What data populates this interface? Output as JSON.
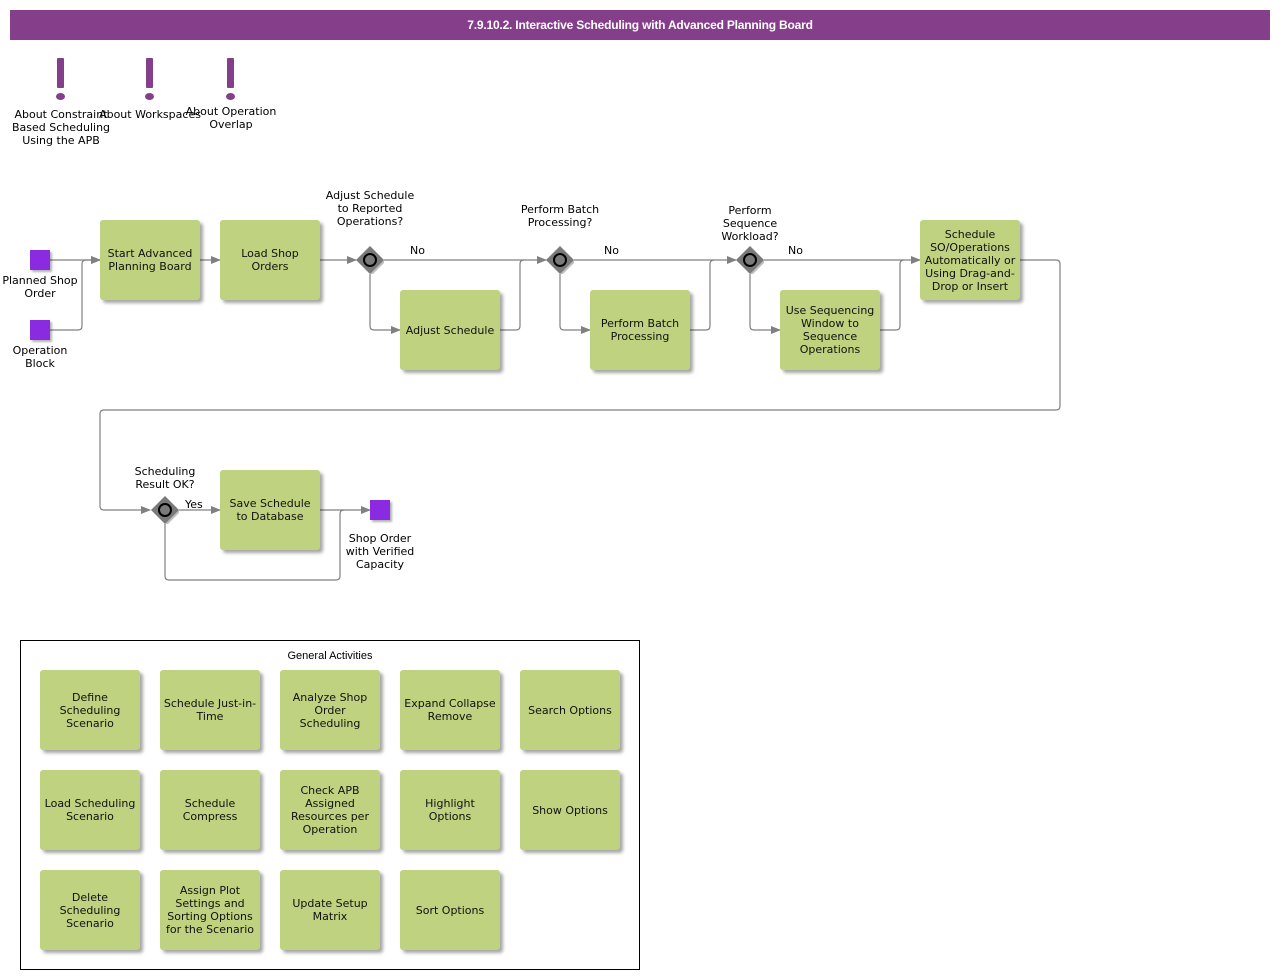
{
  "header": {
    "title": "7.9.10.2. Interactive Scheduling with Advanced Planning Board"
  },
  "notes": [
    {
      "icon": "exclamation-icon",
      "label": "About Constraint Based Scheduling Using the APB"
    },
    {
      "icon": "exclamation-icon",
      "label": "About Workspaces"
    },
    {
      "icon": "exclamation-icon",
      "label": "About Operation Overlap"
    }
  ],
  "events": {
    "planned_shop_order": "Planned Shop Order",
    "operation_block": "Operation Block",
    "end_event": "Shop Order with Verified Capacity"
  },
  "tasks": {
    "start_apb": "Start Advanced Planning Board",
    "load_shop_orders": "Load Shop Orders",
    "adjust_schedule": "Adjust Schedule",
    "perform_batch": "Perform Batch Processing",
    "use_sequencing": "Use Sequencing Window to Sequence Operations",
    "schedule_so": "Schedule SO/Operations Automatically or Using Drag-and-Drop or Insert",
    "save_schedule": "Save Schedule to Database"
  },
  "gateways": {
    "adjust_q": "Adjust Schedule to Reported Operations?",
    "batch_q": "Perform Batch Processing?",
    "sequence_q": "Perform Sequence Workload?",
    "result_q": "Scheduling Result OK?"
  },
  "flow_labels": {
    "no": "No",
    "yes": "Yes"
  },
  "general_activities": {
    "title": "General Activities",
    "items": [
      "Define Scheduling Scenario",
      "Schedule Just-in-Time",
      "Analyze Shop Order Scheduling",
      "Expand Collapse Remove",
      "Search Options",
      "Load Scheduling Scenario",
      "Schedule Compress",
      "Check APB Assigned Resources per Operation",
      "Highlight Options",
      "Show Options",
      "Delete Scheduling Scenario",
      "Assign Plot Settings and Sorting Options for the Scenario",
      "Update Setup Matrix",
      "Sort Options"
    ]
  },
  "colors": {
    "header": "#853e8a",
    "task": "#bed27f",
    "event": "#8a2be2",
    "gateway": "#7a7a7a",
    "flow": "#808080"
  }
}
